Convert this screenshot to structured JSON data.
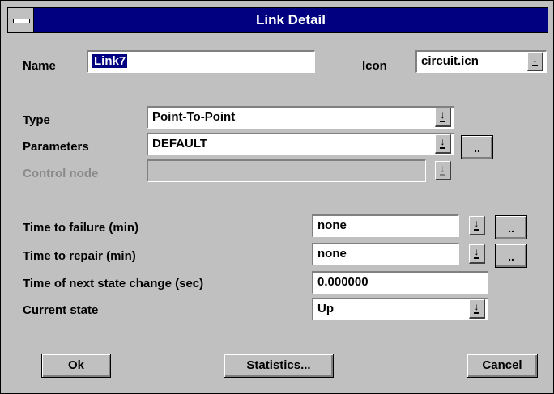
{
  "window": {
    "title": "Link Detail"
  },
  "name": {
    "label": "Name",
    "value": "Link7"
  },
  "icon": {
    "label": "Icon",
    "value": "circuit.icn"
  },
  "type": {
    "label": "Type",
    "value": "Point-To-Point"
  },
  "parameters": {
    "label": "Parameters",
    "value": "DEFAULT",
    "more_label": ".."
  },
  "control_node": {
    "label": "Control node",
    "value": ""
  },
  "time_to_failure": {
    "label": "Time to failure (min)",
    "value": "none",
    "more_label": ".."
  },
  "time_to_repair": {
    "label": "Time to repair (min)",
    "value": "none",
    "more_label": ".."
  },
  "next_state_change": {
    "label": "Time of next state change (sec)",
    "value": "0.000000"
  },
  "current_state": {
    "label": "Current state",
    "value": "Up"
  },
  "buttons": {
    "ok": "Ok",
    "statistics": "Statistics...",
    "cancel": "Cancel"
  },
  "colors": {
    "titlebar": "#000080",
    "face": "#c0c0c0"
  },
  "icons": {
    "system_menu": "system-menu-icon",
    "dropdown": "dropdown-arrow-icon"
  }
}
